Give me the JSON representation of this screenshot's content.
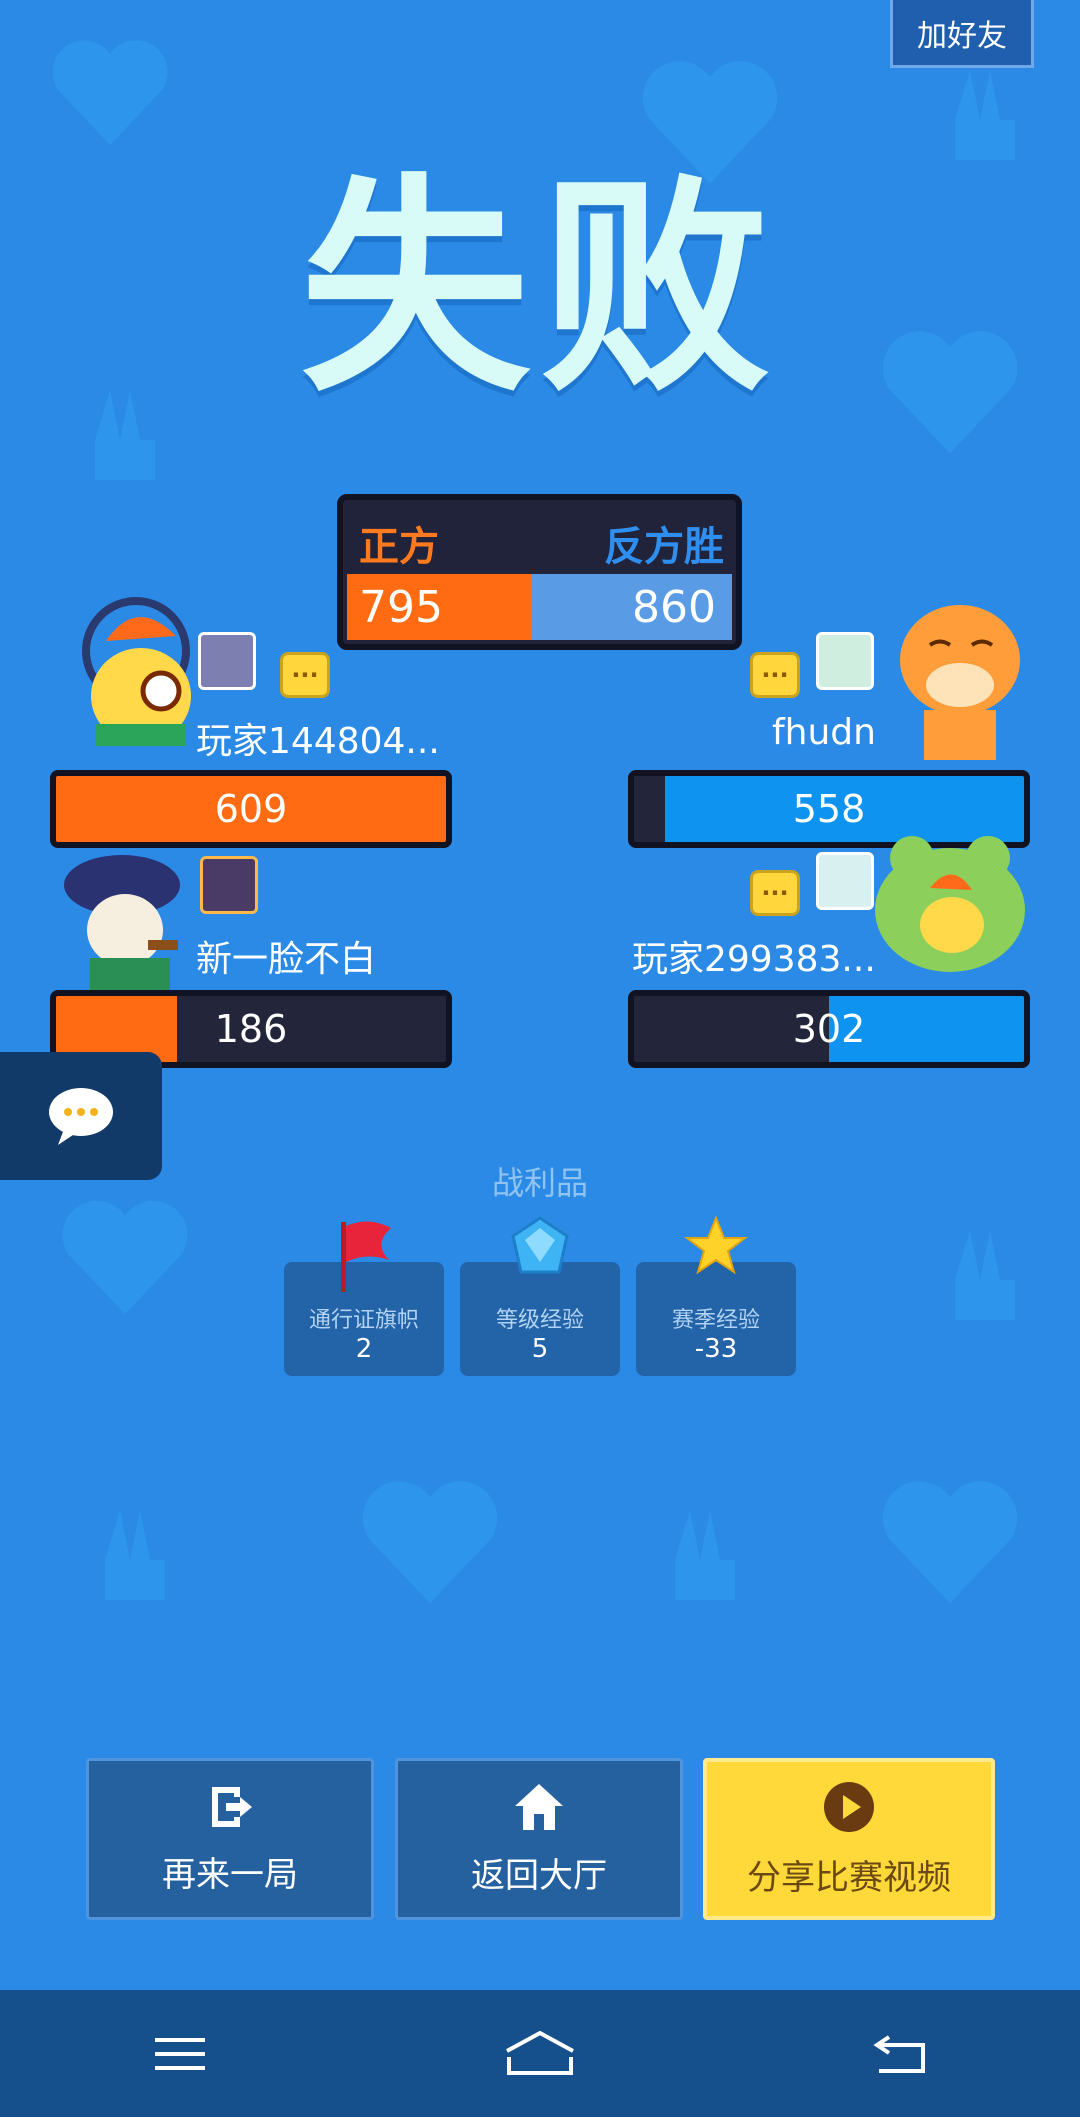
{
  "header": {
    "add_friend_label": "加好友"
  },
  "result": {
    "title": "失败"
  },
  "scoreboard": {
    "left_team": "正方",
    "right_team": "反方胜",
    "left_score": "795",
    "right_score": "860",
    "left_share": 0.48
  },
  "players": [
    {
      "name": "玩家144804...",
      "score": "609",
      "fill": 1.0,
      "team": "left",
      "gender_icon": "female-icon"
    },
    {
      "name": "fhudn",
      "score": "558",
      "fill": 0.92,
      "team": "right",
      "gender_icon": ""
    },
    {
      "name": "新一脸不白",
      "score": "186",
      "fill": 0.31,
      "team": "left",
      "gender_icon": "male-icon"
    },
    {
      "name": "玩家299383...",
      "score": "302",
      "fill": 0.5,
      "team": "right",
      "gender_icon": ""
    }
  ],
  "chat_bubble_text": "···",
  "spoils": {
    "label": "战利品",
    "items": [
      {
        "label": "通行证旗帜",
        "value": "2",
        "icon": "red-flag-icon"
      },
      {
        "label": "等级经验",
        "value": "5",
        "icon": "blue-crystal-icon"
      },
      {
        "label": "赛季经验",
        "value": "-33",
        "icon": "gold-star-icon"
      }
    ]
  },
  "actions": {
    "replay_label": "再来一局",
    "lobby_label": "返回大厅",
    "share_label": "分享比赛视频"
  },
  "colors": {
    "background": "#2a8ae6",
    "orange_team": "#ff6b12",
    "blue_team": "#0f93f0",
    "title": "#d8fbf7",
    "share_button": "#ffd839"
  }
}
